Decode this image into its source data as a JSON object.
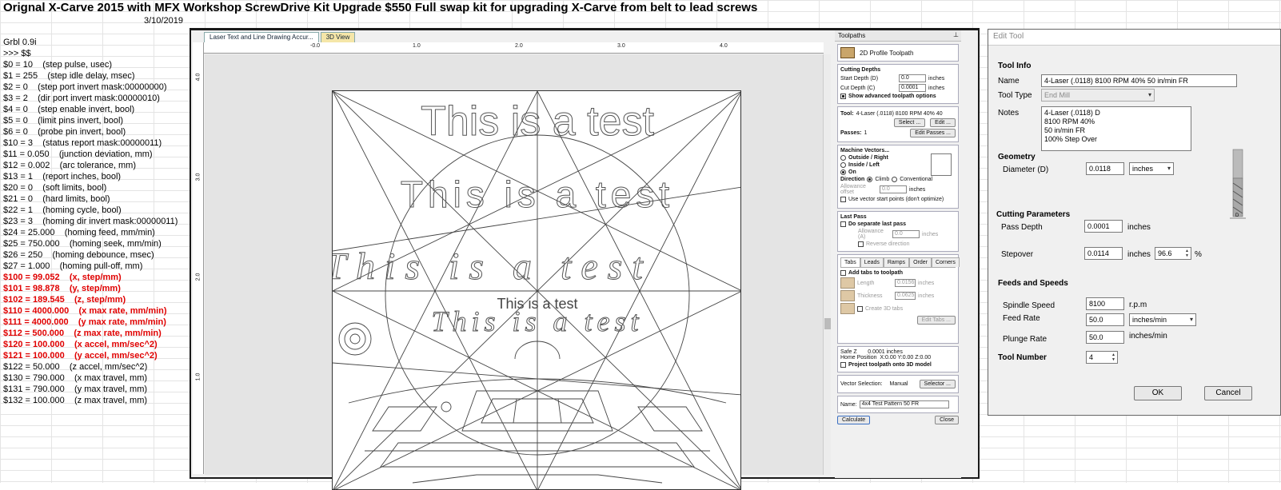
{
  "sheet": {
    "title": "Orignal X-Carve 2015 with MFX Workshop ScrewDrive Kit Upgrade $550 Full swap kit for upgrading X-Carve from belt to lead screws",
    "date": "3/10/2019",
    "grbl_lines": [
      {
        "text": "Grbl 0.9i",
        "red": false
      },
      {
        "text": ">>> $$",
        "red": false
      },
      {
        "text": "$0 = 10    (step pulse, usec)",
        "red": false
      },
      {
        "text": "$1 = 255    (step idle delay, msec)",
        "red": false
      },
      {
        "text": "$2 = 0    (step port invert mask:00000000)",
        "red": false
      },
      {
        "text": "$3 = 2    (dir port invert mask:00000010)",
        "red": false
      },
      {
        "text": "$4 = 0    (step enable invert, bool)",
        "red": false
      },
      {
        "text": "$5 = 0    (limit pins invert, bool)",
        "red": false
      },
      {
        "text": "$6 = 0    (probe pin invert, bool)",
        "red": false
      },
      {
        "text": "$10 = 3    (status report mask:00000011)",
        "red": false
      },
      {
        "text": "$11 = 0.050    (junction deviation, mm)",
        "red": false
      },
      {
        "text": "$12 = 0.002    (arc tolerance, mm)",
        "red": false
      },
      {
        "text": "$13 = 1    (report inches, bool)",
        "red": false
      },
      {
        "text": "$20 = 0    (soft limits, bool)",
        "red": false
      },
      {
        "text": "$21 = 0    (hard limits, bool)",
        "red": false
      },
      {
        "text": "$22 = 1    (homing cycle, bool)",
        "red": false
      },
      {
        "text": "$23 = 3    (homing dir invert mask:00000011)",
        "red": false
      },
      {
        "text": "$24 = 25.000    (homing feed, mm/min)",
        "red": false
      },
      {
        "text": "$25 = 750.000    (homing seek, mm/min)",
        "red": false
      },
      {
        "text": "$26 = 250    (homing debounce, msec)",
        "red": false
      },
      {
        "text": "$27 = 1.000    (homing pull-off, mm)",
        "red": false
      },
      {
        "text": "$100 = 99.052    (x, step/mm)",
        "red": true
      },
      {
        "text": "$101 = 98.878    (y, step/mm)",
        "red": true
      },
      {
        "text": "$102 = 189.545    (z, step/mm)",
        "red": true
      },
      {
        "text": "$110 = 4000.000    (x max rate, mm/min)",
        "red": true
      },
      {
        "text": "$111 = 4000.000    (y max rate, mm/min)",
        "red": true
      },
      {
        "text": "$112 = 500.000    (z max rate, mm/min)",
        "red": true
      },
      {
        "text": "$120 = 100.000    (x accel, mm/sec^2)",
        "red": true
      },
      {
        "text": "$121 = 100.000    (y accel, mm/sec^2)",
        "red": true
      },
      {
        "text": "$122 = 50.000    (z accel, mm/sec^2)",
        "red": false
      },
      {
        "text": "$130 = 790.000    (x max travel, mm)",
        "red": false
      },
      {
        "text": "$131 = 790.000    (y max travel, mm)",
        "red": false
      },
      {
        "text": "$132 = 100.000    (z max travel, mm)",
        "red": false
      }
    ]
  },
  "vcarve": {
    "tabs": [
      "Laser Text and Line Drawing Accur...",
      "3D View"
    ],
    "ruler_top": [
      "-0.0",
      "1.0",
      "2.0",
      "3.0",
      "4.0"
    ],
    "ruler_left": [
      "4.0",
      "3.0",
      "2.0",
      "1.0"
    ],
    "drawing": {
      "text1": "This is a test",
      "text2": "This is a test",
      "text3": "This is a test",
      "text4": "This is a test",
      "text5": "This is a test"
    }
  },
  "toolpaths": {
    "header": "Toolpaths",
    "pin": "⊥",
    "toolpath_name": "2D Profile Toolpath",
    "cutting_depths": "Cutting Depths",
    "start_depth_label": "Start Depth (D)",
    "start_depth": "0.0",
    "cut_depth_label": "Cut Depth (C)",
    "cut_depth": "0.0001",
    "unit": "inches",
    "show_advanced": "Show advanced toolpath options",
    "tool_label": "Tool:",
    "tool_value": "4-Laser (.0118) 8100 RPM 40% 40",
    "select_btn": "Select ...",
    "edit_btn": "Edit ...",
    "passes_label": "Passes:",
    "passes": "1",
    "edit_passes_btn": "Edit Passes ...",
    "machine_vectors": "Machine Vectors...",
    "outside_right": "Outside / Right",
    "inside_left": "Inside / Left",
    "on": "On",
    "direction": "Direction",
    "climb": "Climb",
    "conventional": "Conventional",
    "allowance_offset": "Allowance offset",
    "allowance_value": "0.0",
    "use_vector_start": "Use vector start points (don't optimize)",
    "last_pass": "Last Pass",
    "do_separate": "Do separate last pass",
    "allowance_a": "Allowance (A)",
    "allowance_a_value": "0.0",
    "reverse_direction": "Reverse direction",
    "subtabs": [
      "Tabs",
      "Leads",
      "Ramps",
      "Order",
      "Corners"
    ],
    "add_tabs": "Add tabs to toolpath",
    "length_label": "Length",
    "length_value": "0.0156",
    "thickness_label": "Thickness",
    "thickness_value": "0.0625",
    "create_3d_tabs": "Create 3D tabs",
    "edit_tabs_btn": "Edit Tabs ...",
    "safe_z": "Safe Z       0.0001 inches",
    "home_position": "Home Position  X:0.00 Y:0.00 Z:0.00",
    "project_toolpath": "Project toolpath onto 3D model",
    "vector_selection_label": "Vector Selection:",
    "vector_selection_value": "Manual",
    "selector_btn": "Selector ...",
    "name_label": "Name:",
    "name_value": "4x4 Test Pattern 50 FR",
    "calculate_btn": "Calculate",
    "close_btn": "Close"
  },
  "edit_tool": {
    "title": "Edit Tool",
    "tool_info": "Tool Info",
    "name_label": "Name",
    "name_value": "4-Laser (.0118) 8100 RPM 40% 50 in/min FR",
    "tool_type_label": "Tool Type",
    "tool_type_value": "End Mill",
    "notes_label": "Notes",
    "notes_value": "4-Laser (.0118) D\n8100 RPM 40%\n50 in/min FR\n100% Step Over",
    "geometry": "Geometry",
    "diameter_label": "Diameter (D)",
    "diameter_value": "0.0118",
    "diameter_unit": "inches",
    "cutting_params": "Cutting Parameters",
    "pass_depth_label": "Pass Depth",
    "pass_depth_value": "0.0001",
    "pass_depth_unit": "inches",
    "stepover_label": "Stepover",
    "stepover_value": "0.0114",
    "stepover_unit": "inches",
    "stepover_pct": "96.6",
    "pct_sign": "%",
    "feeds_speeds": "Feeds and Speeds",
    "spindle_label": "Spindle Speed",
    "spindle_value": "8100",
    "spindle_unit": "r.p.m",
    "feed_label": "Feed Rate",
    "feed_value": "50.0",
    "feed_unit": "inches/min",
    "plunge_label": "Plunge Rate",
    "plunge_value": "50.0",
    "plunge_unit": "inches/min",
    "tool_number_label": "Tool Number",
    "tool_number_value": "4",
    "bit_label": "D",
    "ok_btn": "OK",
    "cancel_btn": "Cancel"
  }
}
